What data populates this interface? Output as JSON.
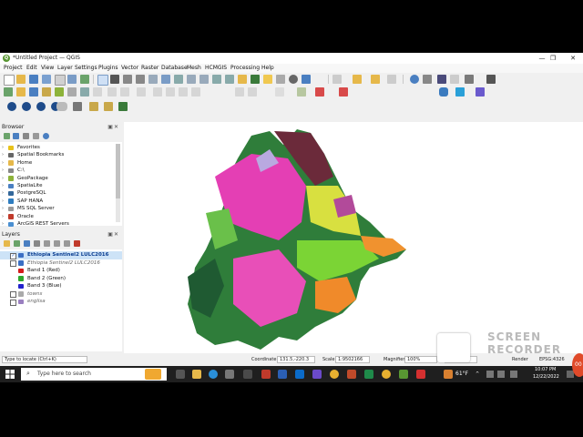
{
  "window": {
    "title": "*Untitled Project — QGIS",
    "minimize": "—",
    "restore": "❐",
    "close": "✕"
  },
  "menu": [
    "Project",
    "Edit",
    "View",
    "Layer",
    "Settings",
    "Plugins",
    "Vector",
    "Raster",
    "Database",
    "Mesh",
    "HCMGIS",
    "Processing",
    "Help"
  ],
  "browser": {
    "title": "Browser",
    "items": [
      {
        "label": "Favorites",
        "icon": "star-icon",
        "color": "#e8c21a"
      },
      {
        "label": "Spatial Bookmarks",
        "icon": "bookmark-icon",
        "color": "#666666"
      },
      {
        "label": "Home",
        "icon": "folder-icon",
        "color": "#e6b84a"
      },
      {
        "label": "C:\\",
        "icon": "drive-icon",
        "color": "#888888"
      },
      {
        "label": "GeoPackage",
        "icon": "geopackage-icon",
        "color": "#8db33a"
      },
      {
        "label": "SpatiaLite",
        "icon": "spatialite-icon",
        "color": "#4a7fc1"
      },
      {
        "label": "PostgreSQL",
        "icon": "postgresql-icon",
        "color": "#33679a"
      },
      {
        "label": "SAP HANA",
        "icon": "sap-hana-icon",
        "color": "#2f7dbf"
      },
      {
        "label": "MS SQL Server",
        "icon": "mssql-icon",
        "color": "#9a9a9a"
      },
      {
        "label": "Oracle",
        "icon": "oracle-icon",
        "color": "#c03a2b"
      },
      {
        "label": "ArcGIS REST Servers",
        "icon": "arcgis-icon",
        "color": "#4a8fd1"
      }
    ]
  },
  "layers": {
    "title": "Layers",
    "items": [
      {
        "label": "Ethiopia Sentinel2 LULC2016",
        "checked": true,
        "italic": false,
        "selected": true,
        "color": "#3b6fc4"
      },
      {
        "label": "Ethiopia Sentinel2 LULC2016",
        "checked": false,
        "italic": true,
        "selected": false,
        "color": "#3b6fc4"
      },
      {
        "label": "Band 1 (Red)",
        "swatch": "#d41c1c"
      },
      {
        "label": "Band 2 (Green)",
        "swatch": "#2da82d"
      },
      {
        "label": "Band 3 (Blue)",
        "swatch": "#2222cc"
      },
      {
        "label": "towns",
        "checked": false,
        "italic": true,
        "color": "#aaaaaa"
      },
      {
        "label": "englisa",
        "checked": false,
        "italic": true,
        "color": "#9a7fc0"
      }
    ]
  },
  "status": {
    "locate_placeholder": "Type to locate (Ctrl+K)",
    "coordinate_label": "Coordinate",
    "coordinate_value": "131.5,-220.3",
    "scale_label": "Scale",
    "scale_value": "1:9502166",
    "magnifier_label": "Magnifier",
    "magnifier_value": "100%",
    "rotation_value": "0.0 °",
    "render_label": "Render",
    "crs": "EPSG:4326"
  },
  "taskbar": {
    "search_placeholder": "Type here to search",
    "temperature": "61°F",
    "time": "10:07 PM",
    "date": "12/22/2022"
  },
  "watermark": {
    "line1": "SCREEN",
    "line2": "RECORDER"
  },
  "record_button": "00"
}
